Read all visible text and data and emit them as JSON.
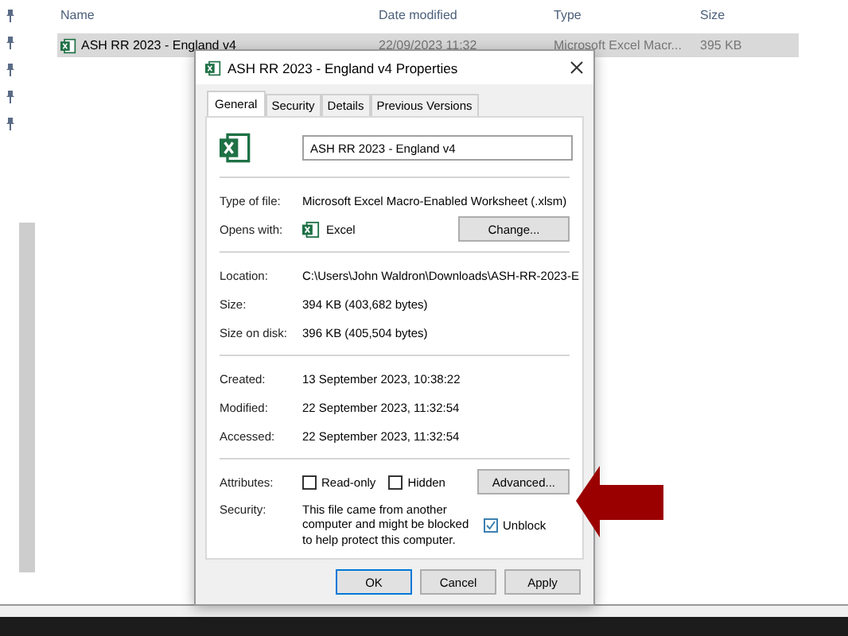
{
  "explorer": {
    "columns": [
      "Name",
      "Date modified",
      "Type",
      "Size"
    ],
    "rows": [
      {
        "name": "ASH RR 2023 - England v4",
        "date": "22/09/2023 11:32",
        "type": "Microsoft Excel Macr...",
        "size": "395 KB",
        "selected": true
      }
    ]
  },
  "dialog": {
    "title": "ASH RR 2023 - England v4 Properties",
    "tabs": [
      {
        "label": "General",
        "selected": true
      },
      {
        "label": "Security",
        "selected": false
      },
      {
        "label": "Details",
        "selected": false
      },
      {
        "label": "Previous Versions",
        "selected": false
      }
    ],
    "filename": "ASH RR 2023 - England v4",
    "type_of_file": {
      "label": "Type of file:",
      "value": "Microsoft Excel Macro-Enabled Worksheet (.xlsm)"
    },
    "opens_with": {
      "label": "Opens with:",
      "value": "Excel",
      "button": "Change..."
    },
    "location_group": [
      {
        "label": "Location:",
        "value": "C:\\Users\\John Waldron\\Downloads\\ASH-RR-2023-E"
      },
      {
        "label": "Size:",
        "value": "394 KB (403,682 bytes)"
      },
      {
        "label": "Size on disk:",
        "value": "396 KB (405,504 bytes)"
      }
    ],
    "date_group": [
      {
        "label": "Created:",
        "value": "13 September 2023, 10:38:22"
      },
      {
        "label": "Modified:",
        "value": "22 September 2023, 11:32:54"
      },
      {
        "label": "Accessed:",
        "value": "22 September 2023, 11:32:54"
      }
    ],
    "attributes": {
      "label": "Attributes:",
      "checkboxes": [
        {
          "label": "Read-only",
          "checked": false
        },
        {
          "label": "Hidden",
          "checked": false
        }
      ],
      "button": "Advanced..."
    },
    "security": {
      "label": "Security:",
      "message": "This file came from another computer and might be blocked to help protect this computer.",
      "unblock": {
        "label": "Unblock",
        "checked": true
      }
    },
    "buttons": [
      {
        "label": "OK",
        "default": true
      },
      {
        "label": "Cancel",
        "default": false
      },
      {
        "label": "Apply",
        "default": false
      }
    ]
  }
}
